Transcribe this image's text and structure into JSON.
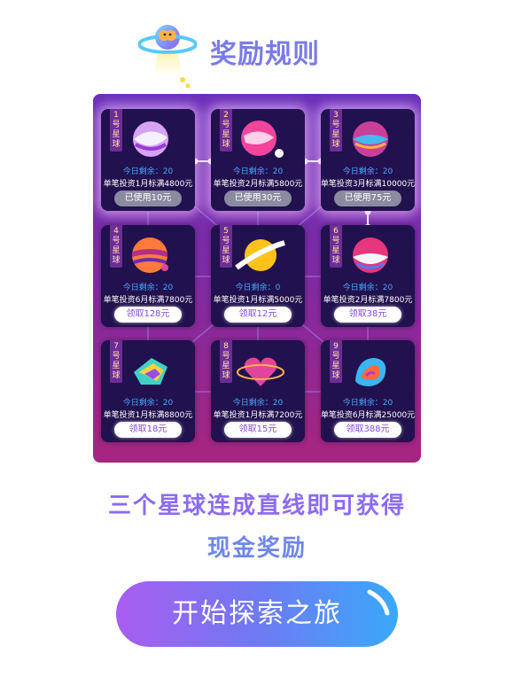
{
  "header": {
    "title": "奖励规则",
    "mascot_icon": "ufo-mascot-icon"
  },
  "cards": [
    {
      "tag": [
        "1",
        "号",
        "星",
        "球"
      ],
      "remain": "今日剩余：20",
      "condition": "单笔投资1月标满4800元",
      "button": "已使用10元",
      "state": "used",
      "planet": "planet-icon"
    },
    {
      "tag": [
        "2",
        "号",
        "星",
        "球"
      ],
      "remain": "今日剩余：20",
      "condition": "单笔投资2月标满5800元",
      "button": "已使用30元",
      "state": "used",
      "planet": "planet-icon"
    },
    {
      "tag": [
        "3",
        "号",
        "星",
        "球"
      ],
      "remain": "今日剩余：20",
      "condition": "单笔投资3月标满10000元",
      "button": "已使用75元",
      "state": "used",
      "planet": "planet-icon"
    },
    {
      "tag": [
        "4",
        "号",
        "星",
        "球"
      ],
      "remain": "今日剩余：20",
      "condition": "单笔投资6月标满7800元",
      "button": "领取128元",
      "state": "claim",
      "planet": "planet-icon"
    },
    {
      "tag": [
        "5",
        "号",
        "星",
        "球"
      ],
      "remain": "今日剩余：0",
      "condition": "单笔投资1月标满5000元",
      "button": "领取12元",
      "state": "claim",
      "planet": "planet-icon"
    },
    {
      "tag": [
        "6",
        "号",
        "星",
        "球"
      ],
      "remain": "今日剩余：20",
      "condition": "单笔投资2月标满7800元",
      "button": "领取38元",
      "state": "claim",
      "planet": "planet-icon"
    },
    {
      "tag": [
        "7",
        "号",
        "星",
        "球"
      ],
      "remain": "今日剩余：20",
      "condition": "单笔投资1月标满8800元",
      "button": "领取18元",
      "state": "claim",
      "planet": "planet-icon"
    },
    {
      "tag": [
        "8",
        "号",
        "星",
        "球"
      ],
      "remain": "今日剩余：20",
      "condition": "单笔投资1月标满7200元",
      "button": "领取15元",
      "state": "claim",
      "planet": "planet-icon"
    },
    {
      "tag": [
        "9",
        "号",
        "星",
        "球"
      ],
      "remain": "今日剩余：20",
      "condition": "单笔投资6月标满25000元",
      "button": "领取388元",
      "state": "claim",
      "planet": "planet-icon"
    }
  ],
  "slogan": {
    "line1": "三个星球连成直线即可获得",
    "line2": "现金奖励"
  },
  "start_button": {
    "label": "开始探索之旅"
  },
  "colors": {
    "accent": "#7a7be8",
    "board_top": "#6a2fb8",
    "board_bottom": "#a7257f",
    "remain": "#4aa9ff",
    "claim_text": "#8a4be0"
  }
}
